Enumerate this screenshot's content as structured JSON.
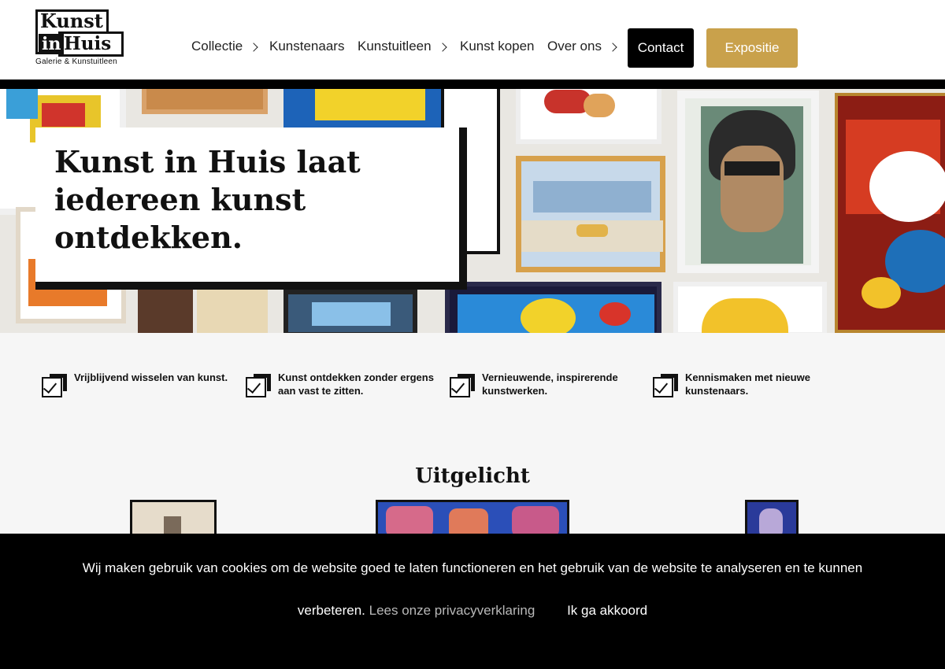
{
  "logo": {
    "line1": "Kunst",
    "line2a": "in",
    "line2b": "Huis",
    "tagline": "Galerie & Kunstuitleen"
  },
  "nav": {
    "items": [
      {
        "label": "Collectie",
        "has_submenu": true
      },
      {
        "label": "Kunstenaars",
        "has_submenu": false
      },
      {
        "label": "Kunstuitleen",
        "has_submenu": true
      },
      {
        "label": "Kunst kopen",
        "has_submenu": false
      },
      {
        "label": "Over ons",
        "has_submenu": true
      }
    ],
    "contact_label": "Contact",
    "expo_label": "Expositie"
  },
  "hero": {
    "title": "Kunst in Huis laat iedereen kunst ontdekken."
  },
  "features": [
    {
      "text": "Vrijblijvend wisselen van kunst."
    },
    {
      "text": "Kunst ontdekken zonder ergens aan vast te zitten."
    },
    {
      "text": "Vernieuwende, inspirerende kunstwerken."
    },
    {
      "text": "Kennismaken met nieuwe kunstenaars."
    }
  ],
  "featured": {
    "title": "Uitgelicht"
  },
  "cookie": {
    "text_line1": "Wij maken gebruik van cookies om de website goed te laten functioneren en het gebruik van de website te analyseren en te kunnen",
    "text_line2": "verbeteren.",
    "privacy_link": "Lees onze privacyverklaring",
    "accept_label": "Ik ga akkoord"
  },
  "colors": {
    "accent": "#c9a14b",
    "dark": "#000000",
    "background": "#f6f6f6"
  }
}
